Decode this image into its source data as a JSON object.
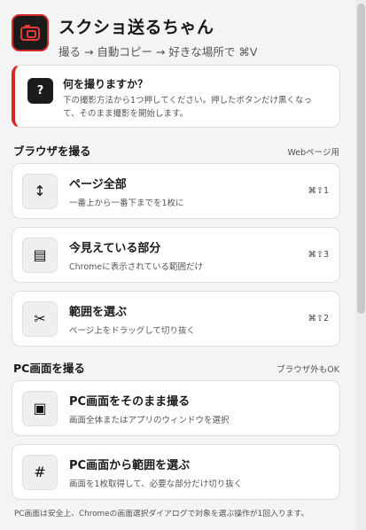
{
  "header": {
    "title": "スクショ送るちゃん",
    "subtitle": "撮る → 自動コピー → 好きな場所で ⌘V"
  },
  "info": {
    "icon": "?",
    "title": "何を撮りますか？",
    "desc_line1": "下の撮影方法から1つ押してください。押したボタンだけ黒くなっ",
    "desc_line2": "て、そのまま撮影を開始します。"
  },
  "browser_section": {
    "title": "ブラウザを撮る",
    "note": "Webページ用",
    "items": [
      {
        "icon": "↕",
        "icon_name": "vertical-arrows-icon",
        "title": "ページ全部",
        "desc": "一番上から一番下までを1枚に",
        "shortcut": "⌘⇧1"
      },
      {
        "icon": "▤",
        "icon_name": "visible-area-icon",
        "title": "今見えている部分",
        "desc": "Chromeに表示されている範囲だけ",
        "shortcut": "⌘⇧3"
      },
      {
        "icon": "✂",
        "icon_name": "scissors-icon",
        "title": "範囲を選ぶ",
        "desc": "ページ上をドラッグして切り抜く",
        "shortcut": "⌘⇧2"
      }
    ]
  },
  "pc_section": {
    "title": "PC画面を撮る",
    "note": "ブラウザ外もOK",
    "items": [
      {
        "icon": "▣",
        "icon_name": "full-screen-icon",
        "title": "PC画面をそのまま撮る",
        "desc": "画面全体またはアプリのウィンドウを選択"
      },
      {
        "icon": "#",
        "icon_name": "grid-icon",
        "title": "PC画面から範囲を選ぶ",
        "desc": "画面を1枚取得して、必要な部分だけ切り抜く"
      }
    ]
  },
  "footnote": "PC画面は安全上、Chromeの画面選択ダイアログで対象を選ぶ操作が1回入ります。",
  "colors": {
    "accent": "#d6282b",
    "dark": "#1b1b1b"
  }
}
